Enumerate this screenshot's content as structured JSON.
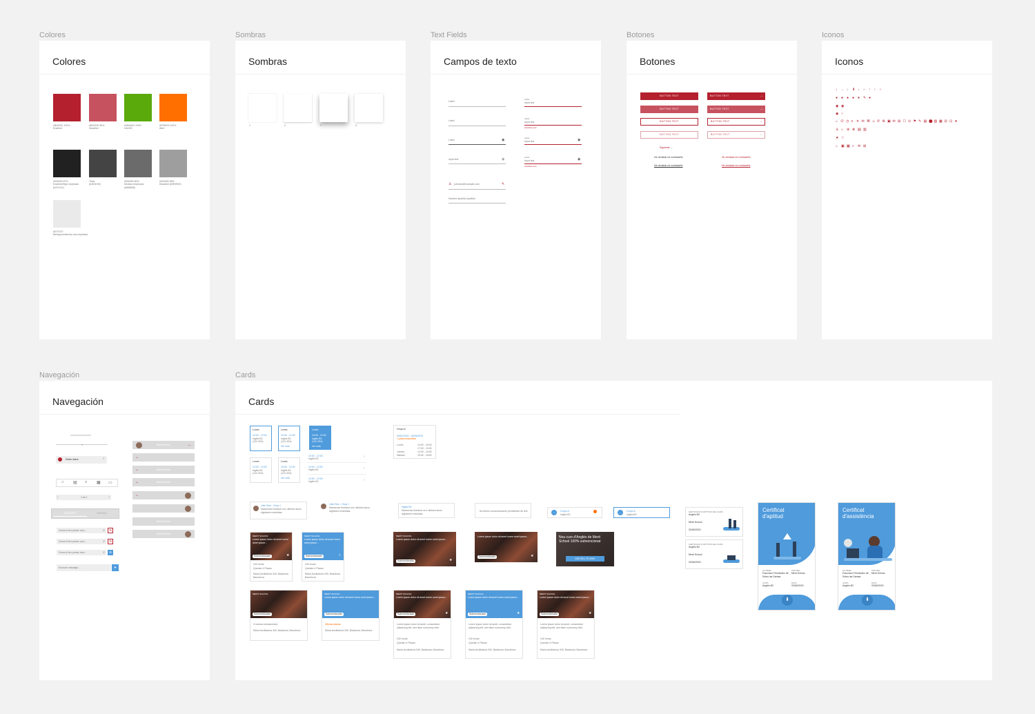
{
  "frames": {
    "colores": {
      "label": "Colores",
      "title": "Colores"
    },
    "sombras": {
      "label": "Sombras",
      "title": "Sombras"
    },
    "textfields": {
      "label": "Text Fields",
      "title": "Campos de texto"
    },
    "botones": {
      "label": "Botones",
      "title": "Botones"
    },
    "iconos": {
      "label": "Iconos",
      "title": "Iconos"
    },
    "navegacion": {
      "label": "Navegación",
      "title": "Navegación"
    },
    "cards": {
      "label": "Cards",
      "title": "Cards"
    }
  },
  "colors": [
    {
      "hex": "#B4202E",
      "line1": "#B4202E 100%",
      "line2": "Enabled"
    },
    {
      "hex": "#C7525F",
      "line1": "#B4202E 80%",
      "line2": "Disabled"
    },
    {
      "hex": "#5AAA0B",
      "line1": "#4DAA00 100%",
      "line2": "Info/OK"
    },
    {
      "hex": "#FF6F00",
      "line1": "#FF6E00 100%",
      "line2": "Alert"
    },
    {
      "hex": "#212121",
      "line1": "#000000 87%",
      "line2": "Enabled/High emphasis (#212121)"
    },
    {
      "hex": "#444444",
      "line1": "Texts",
      "line2": "(#4E4E4E)"
    },
    {
      "hex": "#6B6B6B",
      "line1": "#000000 60%",
      "line2": "Medium emphasis (#666666)"
    },
    {
      "hex": "#9E9E9E",
      "line1": "#000000 38%",
      "line2": "Disabled (#9E9E9E)"
    },
    {
      "hex": "#EAEAEA",
      "line1": "#E7E7E7",
      "line2": "Backgrounds/very low emphasis"
    }
  ],
  "shadows": [
    "1",
    "2",
    "3",
    "4"
  ],
  "textfields": {
    "label": "Label",
    "label_small": "Label",
    "input_text": "Input text",
    "input_placeholder": "Input text",
    "helper": "Assistive text",
    "email": "johndoe@example.com",
    "name": "Nombre Apellido Apellido"
  },
  "buttons": {
    "text": "BUTTON TEXT",
    "next": "Siguiente",
    "forgot": "He olvidado mi contraseña"
  },
  "nav": {
    "edit": "Editar datos",
    "pager": "1 de 1",
    "tab_active": "ASIGNATS",
    "tab_inactive": "AGENDA",
    "search": "Cerca el teu primer curs...",
    "write": "Escriure missatge...",
    "school": "Merit School"
  },
  "cards": {
    "day": "Lunes",
    "time": "10:00 - 12:00",
    "course": "Inglés B2",
    "room": "(124 2D4)",
    "more": "Ver más",
    "group": "Grupo A",
    "dates": "03/01/2020 - 30/06/2020",
    "requirements": "1 plaza disponible",
    "schedule": [
      {
        "day": "Lunes",
        "time": "14:00 - 16:30"
      },
      {
        "day": "",
        "time": "17:00 - 19:00"
      },
      {
        "day": "Jueves",
        "time": "14:00 - 16:30"
      },
      {
        "day": "Sábado",
        "time": "15:30 - 18:00"
      }
    ],
    "chat_name": "Julio Sinn - Grup 1",
    "chat_msg": "Maecenas tincidunt orci ultricies lacus dignissim molestias.",
    "no_chats": "No tienes conversaciones pendientes de leer",
    "cert_aptitud": "Certificat d'aptitud",
    "cert_assist": "Certificat d'assistència",
    "cert_small": "CERTIFICAT D'APTITUD DEL CURS",
    "cert_course": "Anglès B2",
    "cert_center": "Merit School",
    "cert_date": "03/06/2020",
    "student": "Francisco Fernández de Sotos las Santas",
    "merit": "MERIT SCHOOL",
    "lorem_title": "Lorem ipsum dolor sit amet lorem amet ipsum...",
    "lorem_body": "Lorem ipsum dolor sit amet, consectetur adipiscing elit, sed diam nonummy nibh.",
    "tag": "Subvencionado",
    "hours": "240 horas",
    "places": "Quedan 4 Plazas",
    "address": "María Auxiliadora 340, Badalona, Barcelona",
    "new_course": "Nou curs d'Anglès de Merit School 100% subvencionat",
    "cta": "INSCRIU-TE ARA!",
    "last_places": "Últimas plazas",
    "new_sims": "3 nuevas simulaciones"
  }
}
